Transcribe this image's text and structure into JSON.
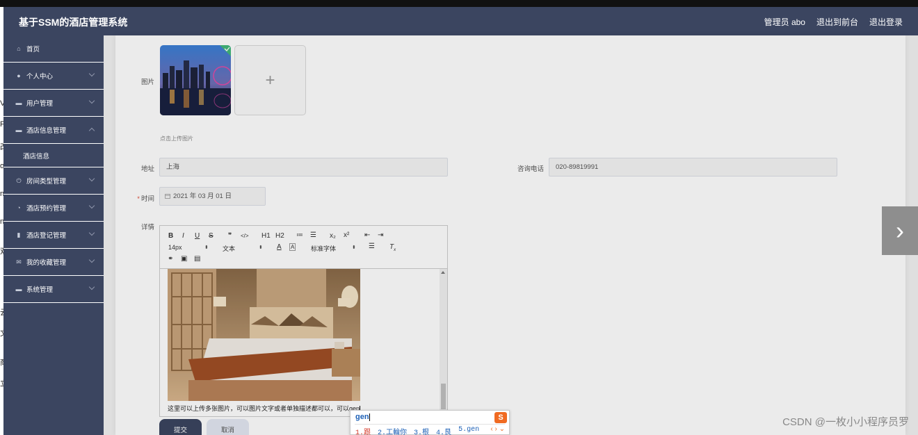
{
  "header": {
    "title": "基于SSM的酒店管理系统",
    "nav": [
      "管理员 abo",
      "退出到前台",
      "退出登录"
    ]
  },
  "left_edge_chars": [
    "V",
    "F",
    "改",
    "o",
    "n",
    "n",
    "双",
    "云",
    "文",
    "商",
    "立"
  ],
  "sidebar": {
    "items": [
      {
        "label": "首页",
        "icon": "home-icon",
        "glyph": "⌂"
      },
      {
        "label": "个人中心",
        "icon": "user-icon",
        "glyph": "●",
        "chevron": "down"
      },
      {
        "label": "用户管理",
        "icon": "list-icon",
        "glyph": "▬",
        "chevron": "down"
      },
      {
        "label": "酒店信息管理",
        "icon": "list-icon",
        "glyph": "▬",
        "chevron": "up"
      },
      {
        "label": "酒店信息",
        "submenu": true
      },
      {
        "label": "房间类型管理",
        "icon": "power-icon",
        "glyph": "⏻",
        "chevron": "down"
      },
      {
        "label": "酒店预约管理",
        "icon": "gauge-icon",
        "glyph": "◔",
        "chevron": "down"
      },
      {
        "label": "酒店登记管理",
        "icon": "bar-chart-icon",
        "glyph": "▮",
        "chevron": "down"
      },
      {
        "label": "我的收藏管理",
        "icon": "mail-icon",
        "glyph": "✉",
        "chevron": "down"
      },
      {
        "label": "系统管理",
        "icon": "list-icon",
        "glyph": "▬",
        "chevron": "down"
      }
    ]
  },
  "form": {
    "image_label": "图片",
    "upload_plus": "+",
    "upload_hint": "点击上传图片",
    "address_label": "地址",
    "address_value": "上海",
    "phone_label": "咨询电话",
    "phone_value": "020-89819991",
    "time_required_mark": "*",
    "time_label": "时间",
    "time_value": "2021 年 03 月 01 日",
    "detail_label": "详情"
  },
  "editor": {
    "toolbar_row1": [
      "B",
      "I",
      "U",
      "S",
      "❞",
      "</>",
      "H1",
      "H2",
      "≔",
      "☰",
      "x₂",
      "x²",
      "⇤",
      "⇥"
    ],
    "font_size": "14px",
    "block_format": "文本",
    "font_family": "标准字体",
    "text": "这里可以上传多张图片，可以图片文字或者单独描述都可以，可以gen"
  },
  "buttons": {
    "submit": "提交",
    "cancel": "取消"
  },
  "ime": {
    "composition": "gen",
    "logo": "S",
    "candidates": [
      "1.跟",
      "2.工輪你",
      "3.根",
      "4.艮",
      "5.gen"
    ],
    "arrows": "‹ › ⌄"
  },
  "carousel_next": "›",
  "watermark": "CSDN @一枚小小程序员罗"
}
